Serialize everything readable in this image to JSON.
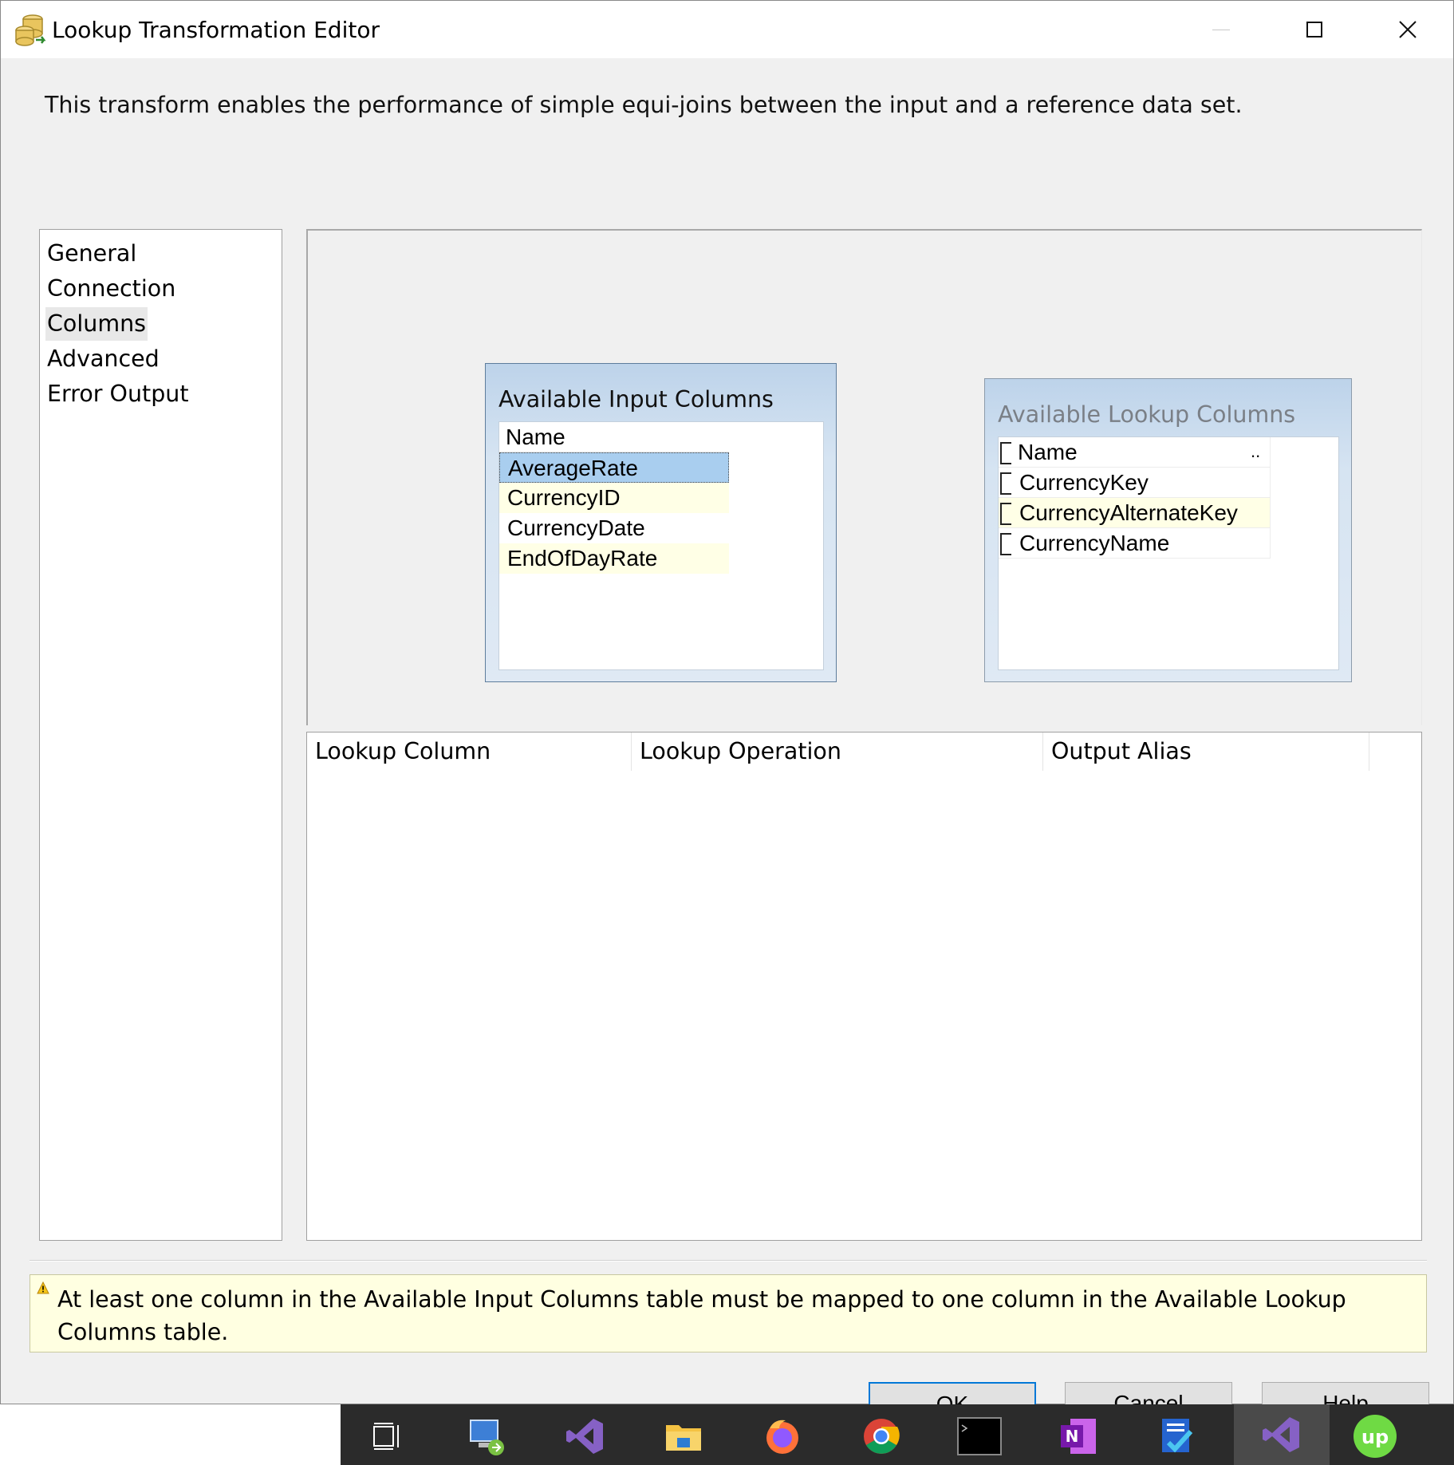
{
  "window": {
    "title": "Lookup Transformation Editor",
    "icon": "lookup-transform-icon"
  },
  "description": "This transform enables the performance of simple equi-joins between the input and a reference data set.",
  "nav": {
    "items": [
      {
        "label": "General",
        "selected": false
      },
      {
        "label": "Connection",
        "selected": false
      },
      {
        "label": "Columns",
        "selected": true
      },
      {
        "label": "Advanced",
        "selected": false
      },
      {
        "label": "Error Output",
        "selected": false
      }
    ]
  },
  "input_columns": {
    "title": "Available Input Columns",
    "header": "Name",
    "rows": [
      "AverageRate",
      "CurrencyID",
      "CurrencyDate",
      "EndOfDayRate"
    ]
  },
  "lookup_columns": {
    "title": "Available Lookup Columns",
    "header": "Name",
    "header_extra": "..",
    "rows": [
      "CurrencyKey",
      "CurrencyAlternateKey",
      "CurrencyName"
    ]
  },
  "grid": {
    "headers": [
      "Lookup Column",
      "Lookup Operation",
      "Output Alias"
    ]
  },
  "warning": {
    "icon": "warning-icon",
    "text": "At least one column in the Available Input Columns table must be mapped to one column in the Available Lookup Columns table."
  },
  "buttons": {
    "ok": "OK",
    "cancel": "Cancel",
    "help": "Help"
  },
  "taskbar": {
    "icons": [
      "task-view-icon",
      "remote-desktop-icon",
      "visual-studio-icon",
      "file-explorer-icon",
      "firefox-icon",
      "chrome-icon",
      "terminal-icon",
      "onenote-icon",
      "todo-icon",
      "visual-studio-active-icon",
      "upwork-icon"
    ]
  },
  "colors": {
    "selection": "#a9ceef",
    "alt_row": "#ffffe6",
    "warning_bg": "#ffffe1",
    "taskbar": "#2b2b2b"
  }
}
